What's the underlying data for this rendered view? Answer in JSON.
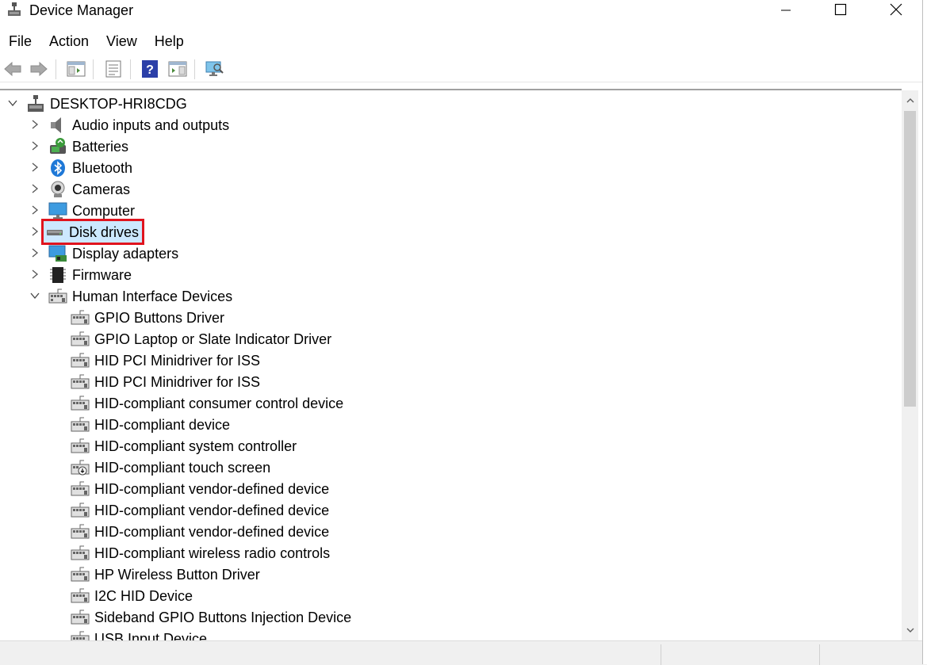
{
  "window": {
    "title": "Device Manager"
  },
  "menu": [
    "File",
    "Action",
    "View",
    "Help"
  ],
  "toolbar_icons": [
    "back-icon",
    "forward-icon",
    "show-hide-console-tree-icon",
    "properties-icon",
    "help-icon",
    "action-pane-icon",
    "scan-hardware-icon"
  ],
  "tree": {
    "root": "DESKTOP-HRI8CDG",
    "categories": [
      {
        "label": "Audio inputs and outputs",
        "icon": "speaker-icon",
        "expanded": false
      },
      {
        "label": "Batteries",
        "icon": "battery-icon",
        "expanded": false
      },
      {
        "label": "Bluetooth",
        "icon": "bluetooth-icon",
        "expanded": false
      },
      {
        "label": "Cameras",
        "icon": "camera-icon",
        "expanded": false
      },
      {
        "label": "Computer",
        "icon": "monitor-icon",
        "expanded": false
      },
      {
        "label": "Disk drives",
        "icon": "disk-drive-icon",
        "expanded": false,
        "selected": true
      },
      {
        "label": "Display adapters",
        "icon": "display-adapter-icon",
        "expanded": false
      },
      {
        "label": "Firmware",
        "icon": "firmware-chip-icon",
        "expanded": false
      },
      {
        "label": "Human Interface Devices",
        "icon": "hid-icon",
        "expanded": true
      }
    ],
    "hid_devices": [
      "GPIO Buttons Driver",
      "GPIO Laptop or Slate Indicator Driver",
      "HID PCI Minidriver for ISS",
      "HID PCI Minidriver for ISS",
      "HID-compliant consumer control device",
      "HID-compliant device",
      "HID-compliant system controller",
      "HID-compliant touch screen",
      "HID-compliant vendor-defined device",
      "HID-compliant vendor-defined device",
      "HID-compliant vendor-defined device",
      "HID-compliant wireless radio controls",
      "HP Wireless Button Driver",
      "I2C HID Device",
      "Sideband GPIO Buttons Injection Device",
      "USB Input Device"
    ]
  },
  "colors": {
    "selection_bg": "#cce8ff",
    "highlight_box": "#e0141e"
  }
}
